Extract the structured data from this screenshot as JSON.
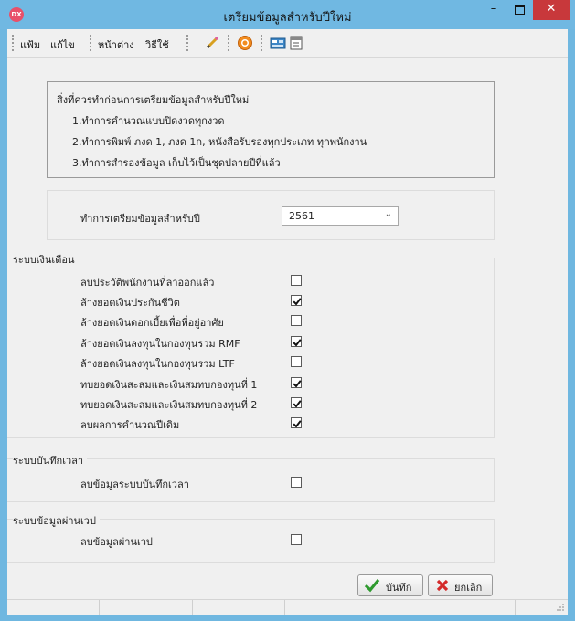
{
  "window": {
    "app_icon_text": "DX",
    "title": "เตรียมข้อมูลสำหรับปีใหม่",
    "minimize": "–",
    "close": "✕"
  },
  "menu": {
    "items": [
      "แฟ้ม",
      "แก้ไข",
      "หน้าต่าง",
      "วิธีใช้"
    ]
  },
  "notes": {
    "heading": "สิ่งที่ควรทำก่อนการเตรียมข้อมูลสำหรับปีใหม่",
    "items": [
      "1.ทำการคำนวณแบบปิดงวดทุกงวด",
      "2.ทำการพิมพ์ ภงด 1, ภงด 1ก, หนังสือรับรองทุกประเภท ทุกพนักงาน",
      "3.ทำการสำรองข้อมูล เก็บไว้เป็นชุดปลายปีที่แล้ว"
    ]
  },
  "year": {
    "label": "ทำการเตรียมข้อมูลสำหรับปี",
    "value": "2561"
  },
  "payroll": {
    "title": "ระบบเงินเดือน",
    "options": [
      {
        "label": "ลบประวัติพนักงานที่ลาออกแล้ว",
        "checked": false
      },
      {
        "label": "ล้างยอดเงินประกันชีวิต",
        "checked": true
      },
      {
        "label": "ล้างยอดเงินดอกเบี้ยเพื่อที่อยู่อาศัย",
        "checked": false
      },
      {
        "label": "ล้างยอดเงินลงทุนในกองทุนรวม RMF",
        "checked": true
      },
      {
        "label": "ล้างยอดเงินลงทุนในกองทุนรวม LTF",
        "checked": false
      },
      {
        "label": "ทบยอดเงินสะสมและเงินสมทบกองทุนที่ 1",
        "checked": true
      },
      {
        "label": "ทบยอดเงินสะสมและเงินสมทบกองทุนที่ 2",
        "checked": true
      },
      {
        "label": "ลบผลการคำนวณปีเดิม",
        "checked": true
      }
    ]
  },
  "timeclock": {
    "title": "ระบบบันทึกเวลา",
    "option": {
      "label": "ลบข้อมูลระบบบันทึกเวลา",
      "checked": false
    }
  },
  "web": {
    "title": "ระบบข้อมูลผ่านเวป",
    "option": {
      "label": "ลบข้อมูลผ่านเวป",
      "checked": false
    }
  },
  "actions": {
    "save": "บันทึก",
    "cancel": "ยกเลิก"
  },
  "colors": {
    "titlebar": "#70b8e2",
    "close": "#c8383b",
    "check": "#111111",
    "save_icon": "#2e9a2e",
    "cancel_icon": "#d42a2a"
  }
}
